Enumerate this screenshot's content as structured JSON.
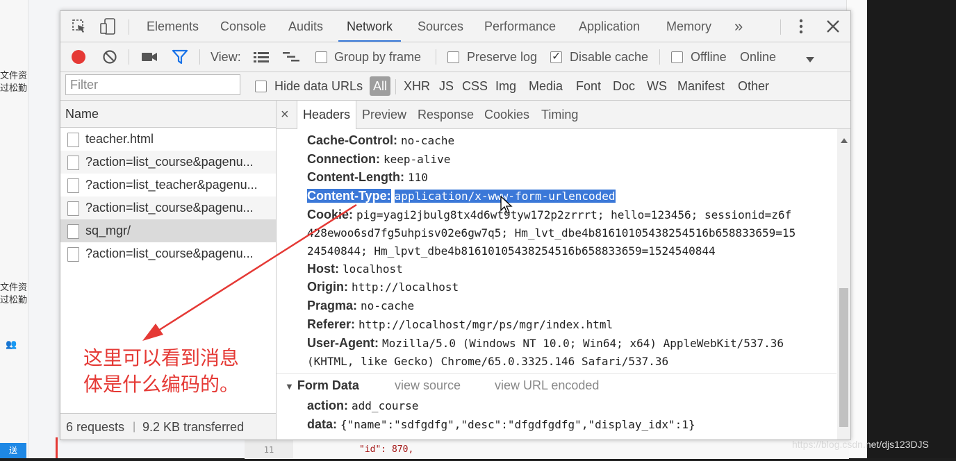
{
  "background": {
    "left_text_1": "文件资\n过松勤",
    "left_text_2": "文件资\n过松勤",
    "send_label": "送",
    "code_line_number": "11",
    "code_line_text": "\"id\": 870,",
    "watermark": "https://blog.csdn.net/djs123DJS"
  },
  "devtools": {
    "tabs": [
      "Elements",
      "Console",
      "Audits",
      "Network",
      "Sources",
      "Performance",
      "Application",
      "Memory"
    ],
    "more_tabs": "»",
    "toolbar": {
      "view_label": "View:",
      "group_by_frame": "Group by frame",
      "preserve_log": "Preserve log",
      "disable_cache": "Disable cache",
      "offline": "Offline",
      "online": "Online"
    },
    "filter": {
      "placeholder": "Filter",
      "hide_data_urls": "Hide data URLs",
      "types": [
        "All",
        "XHR",
        "JS",
        "CSS",
        "Img",
        "Media",
        "Font",
        "Doc",
        "WS",
        "Manifest",
        "Other"
      ]
    },
    "requests": {
      "header": "Name",
      "items": [
        "teacher.html",
        "?action=list_course&pagenu...",
        "?action=list_teacher&pagenu...",
        "?action=list_course&pagenu...",
        "sq_mgr/",
        "?action=list_course&pagenu..."
      ],
      "status_count": "6 requests",
      "status_sep": "|",
      "status_transferred": "9.2 KB transferred"
    },
    "detail_tabs": [
      "Headers",
      "Preview",
      "Response",
      "Cookies",
      "Timing"
    ],
    "close": "×",
    "headers": {
      "cache_control_k": "Cache-Control:",
      "cache_control_v": "no-cache",
      "connection_k": "Connection:",
      "connection_v": "keep-alive",
      "content_length_k": "Content-Length:",
      "content_length_v": "110",
      "content_type_k": "Content-Type:",
      "content_type_v": "application/x-www-form-urlencoded",
      "cookie_k": "Cookie:",
      "cookie_v1": "pig=yagi2jbulg8tx4d6wt9tyw172p2zrrrt; hello=123456; sessionid=z6f",
      "cookie_v2": "428ewoo6sd7fg5uhpisv02e6gw7q5; Hm_lvt_dbe4b81610105438254516b658833659=15",
      "cookie_v3": "24540844; Hm_lpvt_dbe4b81610105438254516b658833659=1524540844",
      "host_k": "Host:",
      "host_v": "localhost",
      "origin_k": "Origin:",
      "origin_v": "http://localhost",
      "pragma_k": "Pragma:",
      "pragma_v": "no-cache",
      "referer_k": "Referer:",
      "referer_v": "http://localhost/mgr/ps/mgr/index.html",
      "ua_k": "User-Agent:",
      "ua_v1": "Mozilla/5.0 (Windows NT 10.0; Win64; x64) AppleWebKit/537.36",
      "ua_v2": "(KHTML, like Gecko) Chrome/65.0.3325.146 Safari/537.36"
    },
    "form_data": {
      "title": "Form Data",
      "view_source": "view source",
      "view_url_encoded": "view URL encoded",
      "action_k": "action:",
      "action_v": "add_course",
      "data_k": "data:",
      "data_v": "{\"name\":\"sdfgdfg\",\"desc\":\"dfgdfgdfg\",\"display_idx\":1}"
    }
  },
  "annotation": "这里可以看到消息\n体是什么编码的。",
  "colors": {
    "accent": "#3879d9",
    "record_red": "#e53935",
    "filter_blue": "#1a73e8",
    "annotation_red": "#e53935"
  }
}
